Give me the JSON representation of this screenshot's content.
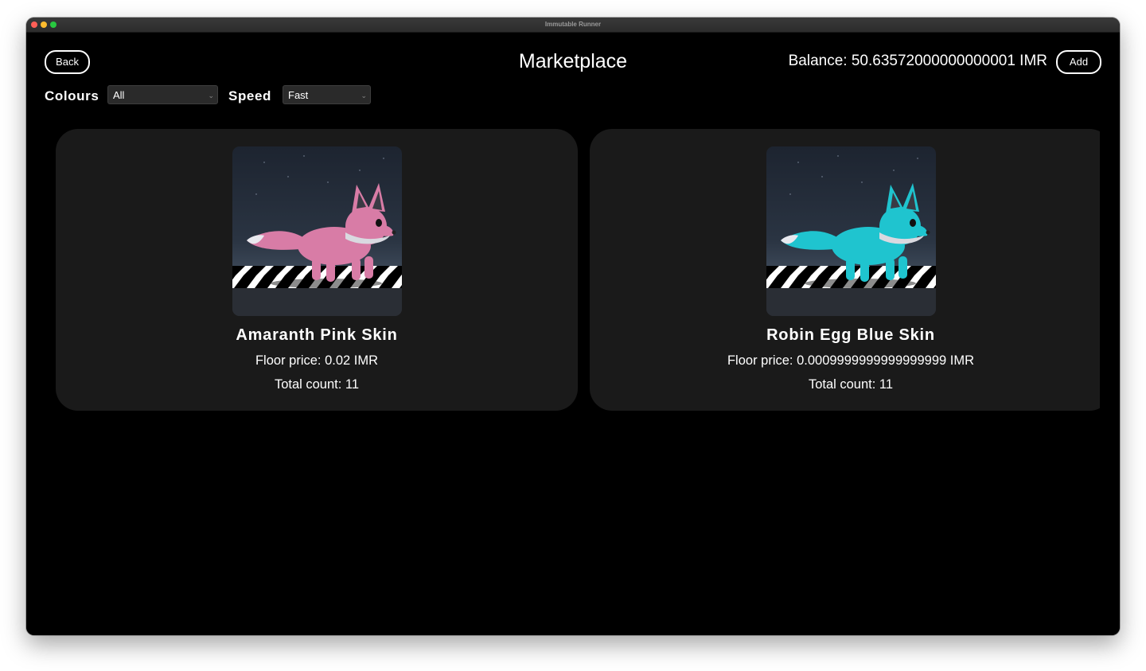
{
  "window": {
    "title": "Immutable Runner"
  },
  "header": {
    "back_label": "Back",
    "title": "Marketplace",
    "balance_text": "Balance: 50.63572000000000001 IMR",
    "add_label": "Add"
  },
  "filters": {
    "colours_label": "Colours",
    "colours_selected": "All",
    "speed_label": "Speed",
    "speed_selected": "Fast"
  },
  "cards": [
    {
      "name": "Amaranth Pink Skin",
      "floor_price": "Floor price: 0.02 IMR",
      "total_count": "Total count: 11",
      "fur_color": "#d87ca6"
    },
    {
      "name": "Robin Egg Blue Skin",
      "floor_price": "Floor price: 0.0009999999999999999 IMR",
      "total_count": "Total count: 11",
      "fur_color": "#1fc4cf"
    }
  ],
  "icons": {
    "dropdown": "chevron-down-icon",
    "traffic_lights": [
      "close-icon",
      "minimize-icon",
      "maximize-icon"
    ]
  },
  "colors": {
    "background": "#000000",
    "card": "#1a1a1a",
    "text": "#ffffff"
  }
}
